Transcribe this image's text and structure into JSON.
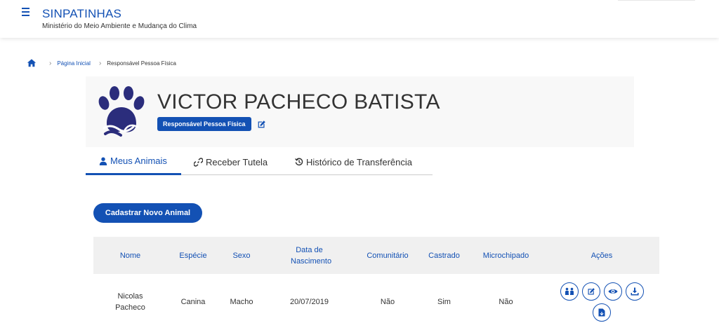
{
  "header": {
    "app_title": "SINPATINHAS",
    "app_subtitle": "Ministério do Meio Ambiente e Mudança do Clima",
    "menu_icon": "hamburger-menu-icon"
  },
  "breadcrumb": {
    "home_icon": "home-icon",
    "items": [
      {
        "label": "Página Inicial"
      },
      {
        "label": "Responsável Pessoa Física"
      }
    ]
  },
  "profile": {
    "name": "VICTOR PACHECO BATISTA",
    "role_badge": "Responsável Pessoa Física"
  },
  "tabs": [
    {
      "label": "Meus Animais",
      "icon": "user-icon",
      "active": true
    },
    {
      "label": "Receber Tutela",
      "icon": "link-icon",
      "active": false
    },
    {
      "label": "Histórico de Transferência",
      "icon": "history-icon",
      "active": false
    }
  ],
  "actions": {
    "new_animal_label": "Cadastrar Novo Animal"
  },
  "table": {
    "columns": [
      "Nome",
      "Espécie",
      "Sexo",
      "Data de Nascimento",
      "Comunitário",
      "Castrado",
      "Microchipado",
      "Ações"
    ],
    "rows": [
      {
        "nome": "Nicolas Pacheco",
        "especie": "Canina",
        "sexo": "Macho",
        "nascimento": "20/07/2019",
        "comunitario": "Não",
        "castrado": "Sim",
        "microchipado": "Não",
        "row_actions": [
          "transfer-icon",
          "edit-icon",
          "view-icon",
          "download-icon",
          "document-icon"
        ]
      }
    ]
  },
  "colors": {
    "primary": "#1351b4",
    "logo_navy": "#2b2d7c",
    "header_bg": "#ffffff",
    "card_bg": "#f8f8f8",
    "table_header_bg": "#f0f0f0"
  }
}
